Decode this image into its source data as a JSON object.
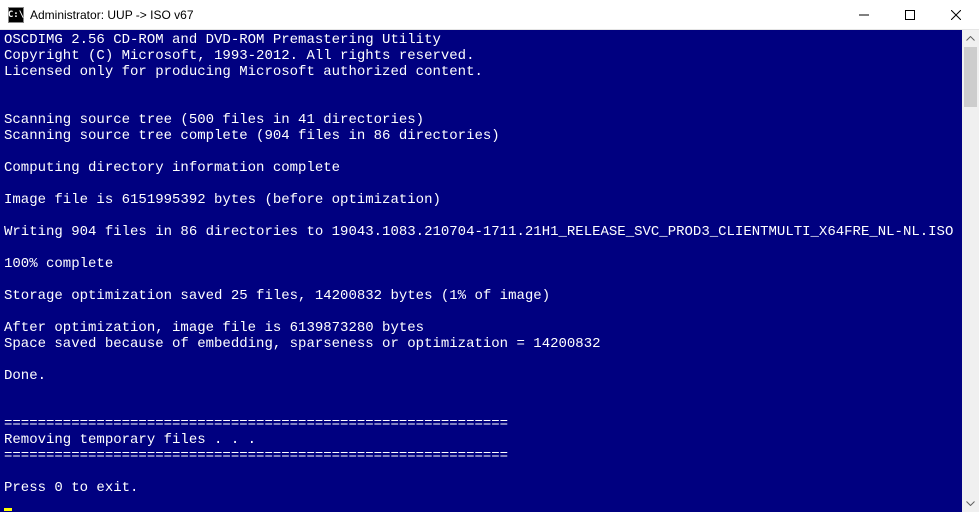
{
  "titlebar": {
    "icon_text": "C:\\",
    "title": "Administrator:  UUP -> ISO v67"
  },
  "console": {
    "lines": [
      "OSCDIMG 2.56 CD-ROM and DVD-ROM Premastering Utility",
      "Copyright (C) Microsoft, 1993-2012. All rights reserved.",
      "Licensed only for producing Microsoft authorized content.",
      "",
      "",
      "Scanning source tree (500 files in 41 directories)",
      "Scanning source tree complete (904 files in 86 directories)",
      "",
      "Computing directory information complete",
      "",
      "Image file is 6151995392 bytes (before optimization)",
      "",
      "Writing 904 files in 86 directories to 19043.1083.210704-1711.21H1_RELEASE_SVC_PROD3_CLIENTMULTI_X64FRE_NL-NL.ISO",
      "",
      "100% complete",
      "",
      "Storage optimization saved 25 files, 14200832 bytes (1% of image)",
      "",
      "After optimization, image file is 6139873280 bytes",
      "Space saved because of embedding, sparseness or optimization = 14200832",
      "",
      "Done.",
      "",
      "",
      "============================================================",
      "Removing temporary files . . .",
      "============================================================",
      "",
      "Press 0 to exit."
    ]
  }
}
